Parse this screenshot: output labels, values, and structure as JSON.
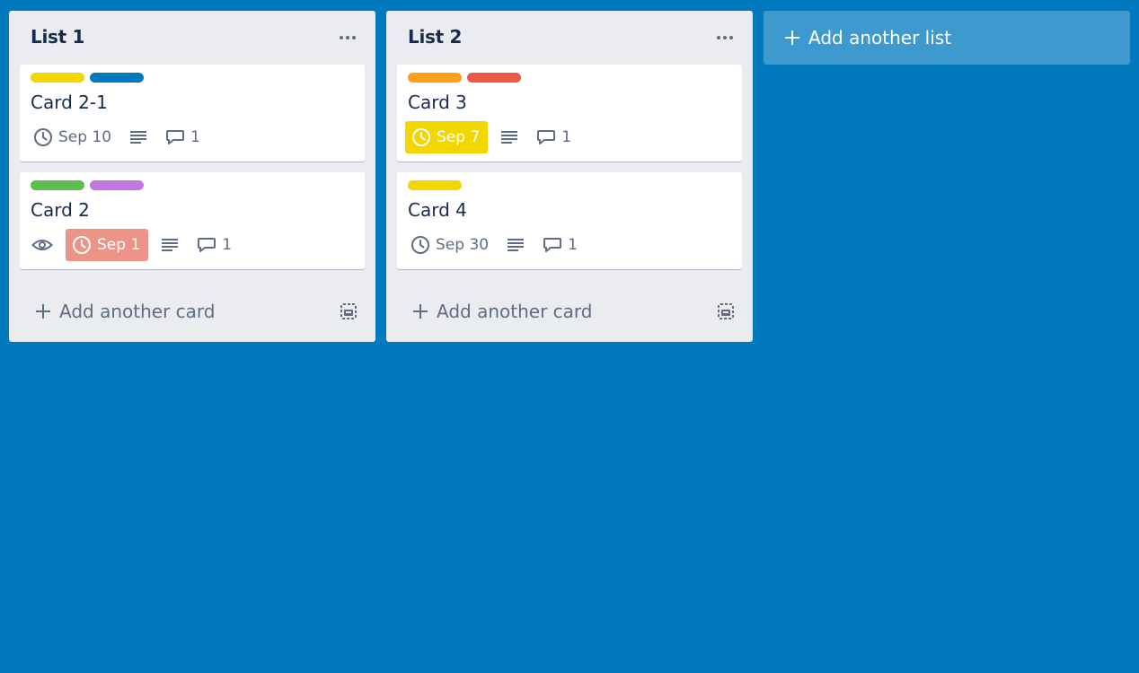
{
  "colors": {
    "board_bg": "#0079bf",
    "list_bg": "#ebecf0",
    "label_yellow": "#f2d600",
    "label_blue": "#0079bf",
    "label_green": "#61bd4f",
    "label_purple": "#c377e0",
    "label_orange": "#ff9f1a",
    "label_red": "#eb5a46",
    "due_soon": "#f2d600",
    "overdue": "#ec9488"
  },
  "lists": [
    {
      "title": "List 1",
      "menu_icon": "ellipsis-icon",
      "cards": [
        {
          "labels": [
            "yellow",
            "blue"
          ],
          "title": "Card 2-1",
          "due": "Sep 10",
          "due_status": "normal",
          "watching": false,
          "comments": "1"
        },
        {
          "labels": [
            "green",
            "purple"
          ],
          "title": "Card 2",
          "due": "Sep 1",
          "due_status": "overdue",
          "watching": true,
          "comments": "1"
        }
      ],
      "add_card_label": "Add another card",
      "template_icon": "card-template-icon"
    },
    {
      "title": "List 2",
      "menu_icon": "ellipsis-icon",
      "cards": [
        {
          "labels": [
            "orange",
            "red"
          ],
          "title": "Card 3",
          "due": "Sep 7",
          "due_status": "due-soon",
          "watching": false,
          "comments": "1"
        },
        {
          "labels": [
            "yellow"
          ],
          "title": "Card 4",
          "due": "Sep 30",
          "due_status": "normal",
          "watching": false,
          "comments": "1"
        }
      ],
      "add_card_label": "Add another card",
      "template_icon": "card-template-icon"
    }
  ],
  "add_list_label": "Add another list"
}
